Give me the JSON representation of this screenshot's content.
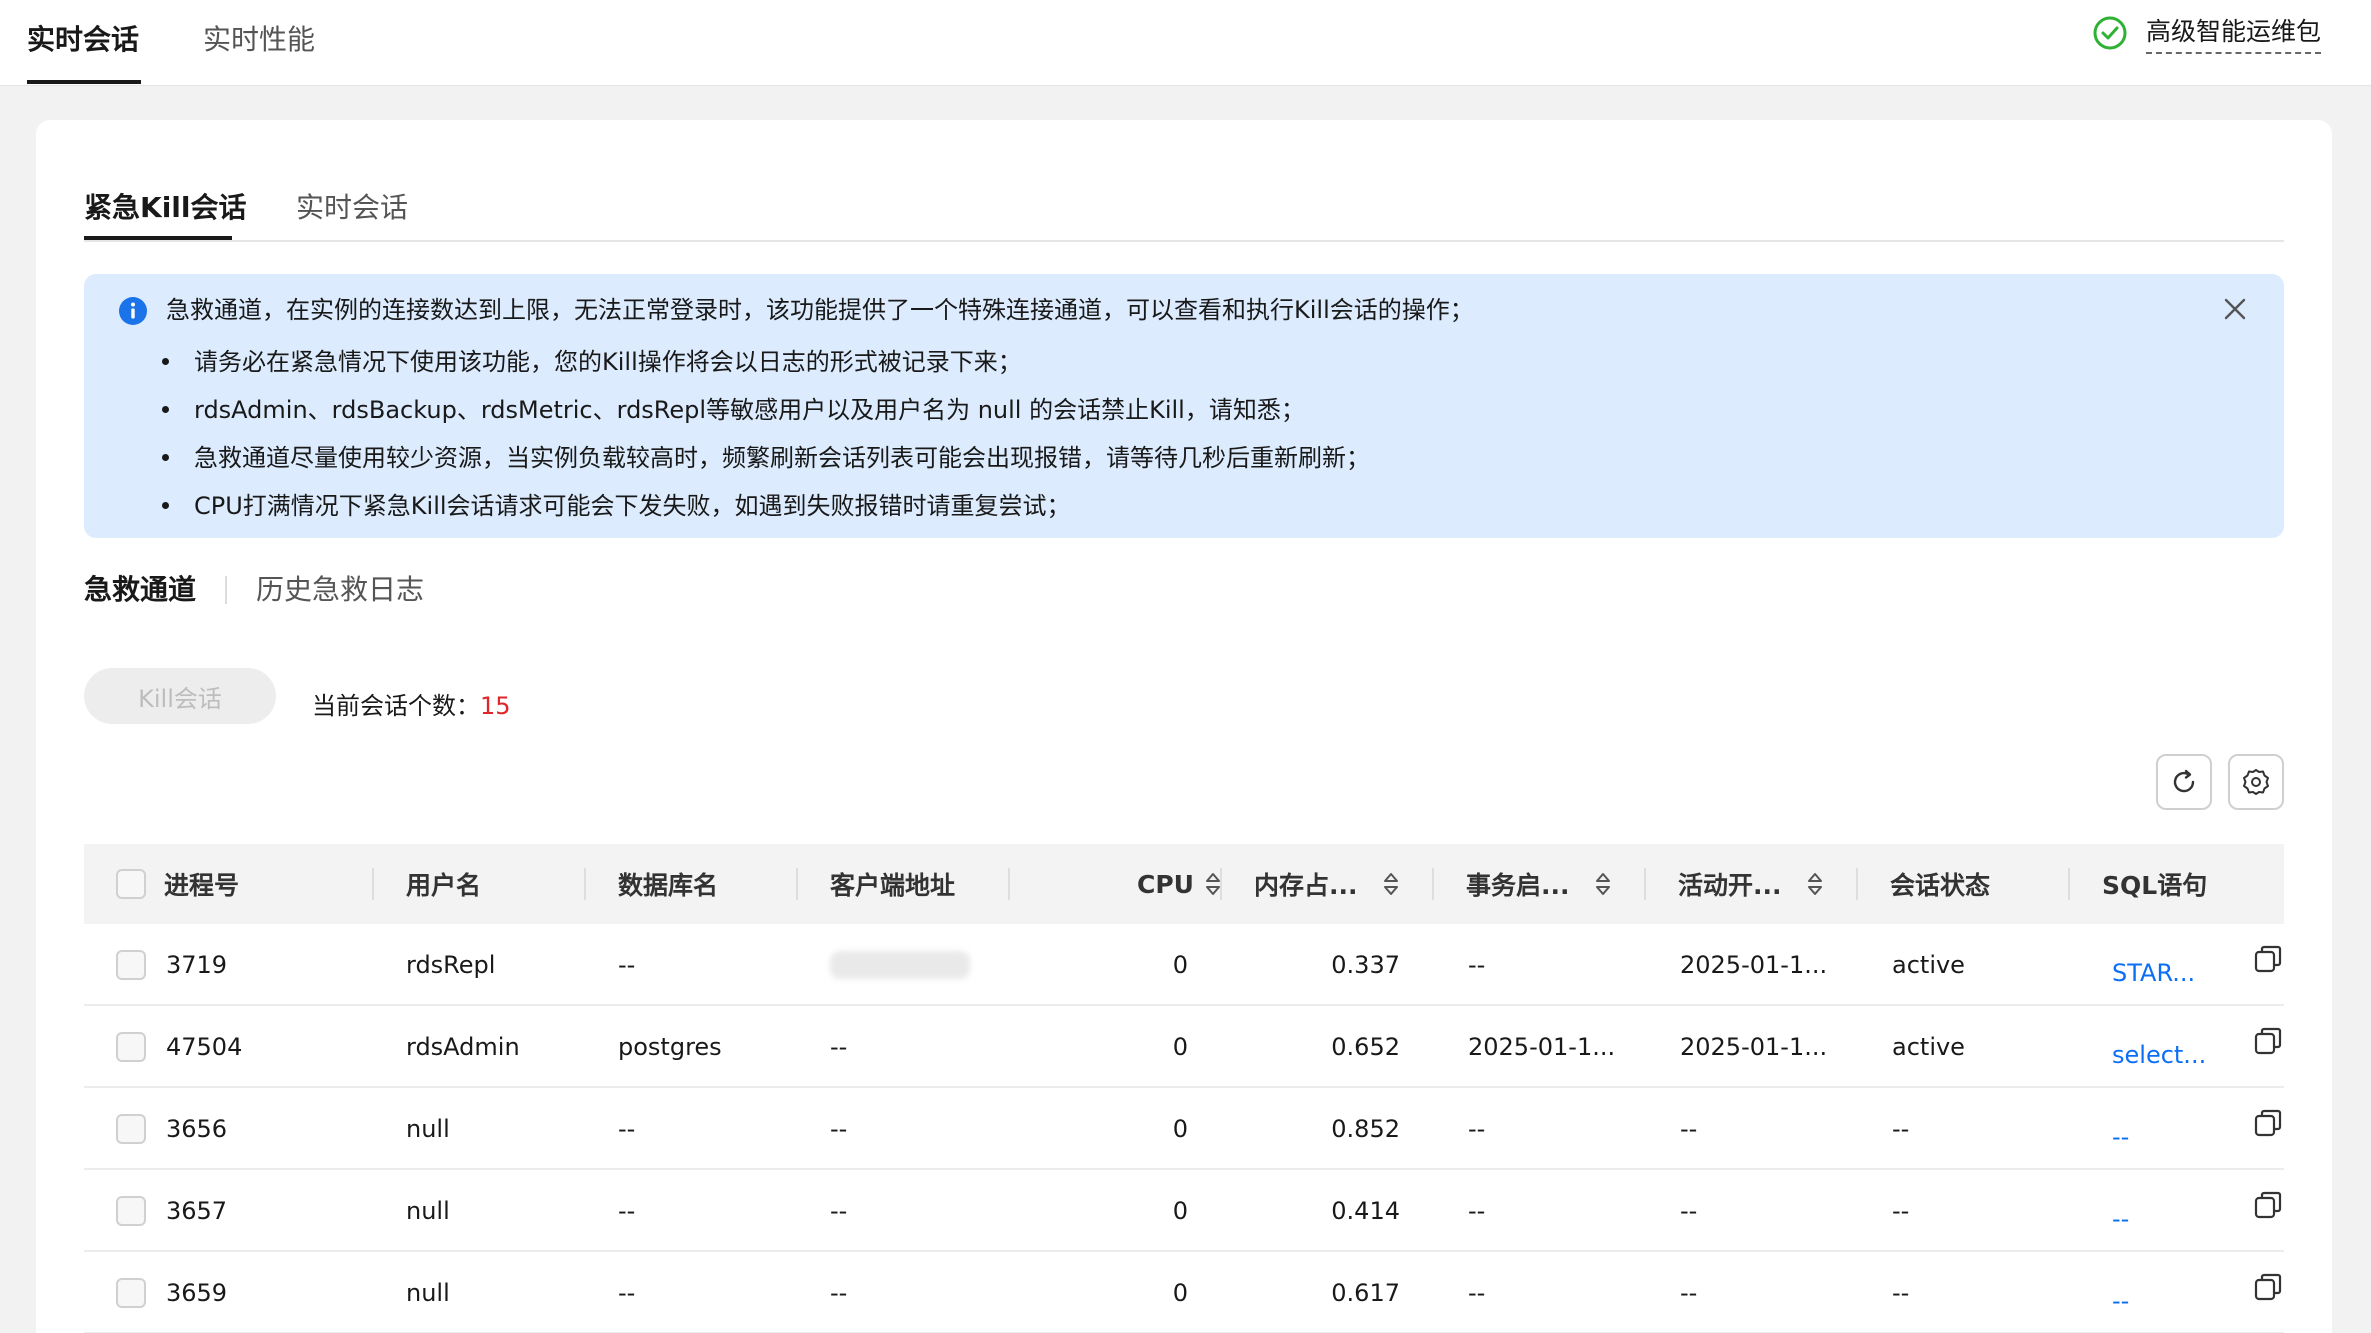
{
  "top_tabs": [
    "实时会话",
    "实时性能"
  ],
  "package": {
    "label": "高级智能运维包",
    "icon": "check-circle-icon",
    "icon_color": "#2fb233"
  },
  "sub_tabs": [
    "紧急Kill会话",
    "实时会话"
  ],
  "notice": {
    "icon": "info-icon",
    "main": "急救通道，在实例的连接数达到上限，无法正常登录时，该功能提供了一个特殊连接通道，可以查看和执行Kill会话的操作；",
    "items": [
      "请务必在紧急情况下使用该功能，您的Kill操作将会以日志的形式被记录下来；",
      "rdsAdmin、rdsBackup、rdsMetric、rdsRepl等敏感用户以及用户名为 null 的会话禁止Kill，请知悉；",
      "急救通道尽量使用较少资源，当实例负载较高时，频繁刷新会话列表可能会出现报错，请等待几秒后重新刷新；",
      "CPU打满情况下紧急Kill会话请求可能会下发失败，如遇到失败报错时请重复尝试；"
    ]
  },
  "channel_tabs": [
    "急救通道",
    "历史急救日志"
  ],
  "kill_button": "Kill会话",
  "session_count": {
    "label": "当前会话个数：",
    "value": "15"
  },
  "table": {
    "headers": [
      "进程号",
      "用户名",
      "数据库名",
      "客户端地址",
      "CPU",
      "内存占...",
      "事务启...",
      "活动开...",
      "会话状态",
      "SQL语句"
    ],
    "rows": [
      [
        "3719",
        "rdsRepl",
        "--",
        "",
        "0",
        "0.337",
        "--",
        "2025-01-1...",
        "active",
        "STAR..."
      ],
      [
        "47504",
        "rdsAdmin",
        "postgres",
        "--",
        "0",
        "0.652",
        "2025-01-1...",
        "2025-01-1...",
        "active",
        "select..."
      ],
      [
        "3656",
        "null",
        "--",
        "--",
        "0",
        "0.852",
        "--",
        "--",
        "--",
        "--"
      ],
      [
        "3657",
        "null",
        "--",
        "--",
        "0",
        "0.414",
        "--",
        "--",
        "--",
        "--"
      ],
      [
        "3659",
        "null",
        "--",
        "--",
        "0",
        "0.617",
        "--",
        "--",
        "--",
        "--"
      ]
    ]
  },
  "colors": {
    "accent_link": "#0b6ff5",
    "count_red": "#e0262a",
    "notice_bg": "#dcebfd",
    "info_blue": "#1a73e8"
  }
}
